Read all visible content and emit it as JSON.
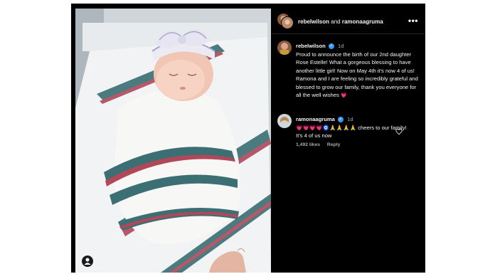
{
  "header": {
    "user1": "rebelwilson",
    "and_text": "and",
    "user2": "ramonaagruma",
    "more_icon": "more-horizontal-icon"
  },
  "caption": {
    "username": "rebelwilson",
    "verified_icon": "verified-badge-icon",
    "time": "1d",
    "text": "Proud to announce the birth of our 2nd daughter Rose Estelle! What a gorgeous blessing to have another little girl! Now on May 4th it's now 4 of us! Ramona and I are feeling so incredibly grateful and blessed to grow our family, thank you everyone for all the well wishes",
    "emoji": "💗"
  },
  "comment": {
    "username": "ramonaagruma",
    "verified_icon": "verified-badge-icon",
    "time": "1d",
    "emojis": "💗💗💗💗🧿🙏🙏🙏🙏",
    "text": "cheers to our family! It's 4 of us now",
    "likes": "1,492 likes",
    "reply": "Reply",
    "like_icon": "heart-outline-icon"
  },
  "photo": {
    "subject": "newborn baby swaddled in striped hospital blanket with bow headband",
    "user_tag_icon": "person-tag-icon"
  },
  "colors": {
    "background": "#000000",
    "verified": "#3897f0",
    "muted": "#a8a8a8",
    "heart": "#f46ba6"
  }
}
